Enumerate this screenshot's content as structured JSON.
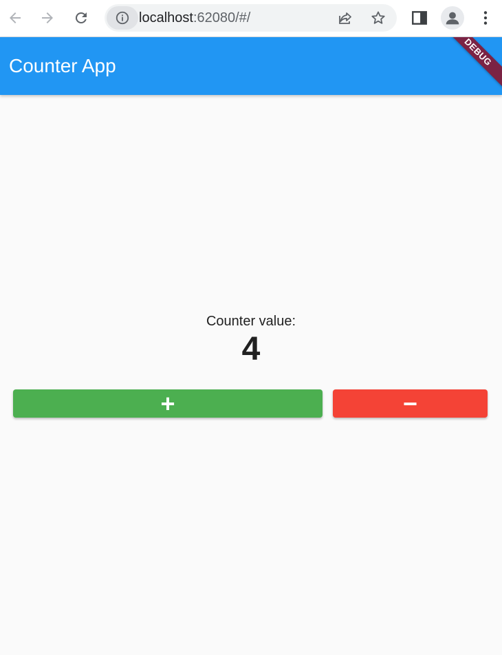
{
  "browser": {
    "url_host": "localhost",
    "url_rest": ":62080/#/",
    "icons": {
      "back": "arrow-left-icon",
      "forward": "arrow-right-icon",
      "reload": "reload-icon",
      "site_info": "info-icon",
      "share": "share-icon",
      "bookmark": "star-icon",
      "side_panel": "side-panel-icon",
      "profile": "account-icon",
      "menu": "more-vert-icon"
    }
  },
  "app": {
    "title": "Counter App",
    "debug_banner": "DEBUG",
    "colors": {
      "app_bar": "#2196f3",
      "debug_banner": "#7b2344",
      "increment": "#4caf50",
      "decrement": "#f44336",
      "background": "#fafafa"
    }
  },
  "counter": {
    "label": "Counter value:",
    "value": "4"
  },
  "buttons": {
    "increment_label": "+",
    "decrement_label": "−"
  }
}
